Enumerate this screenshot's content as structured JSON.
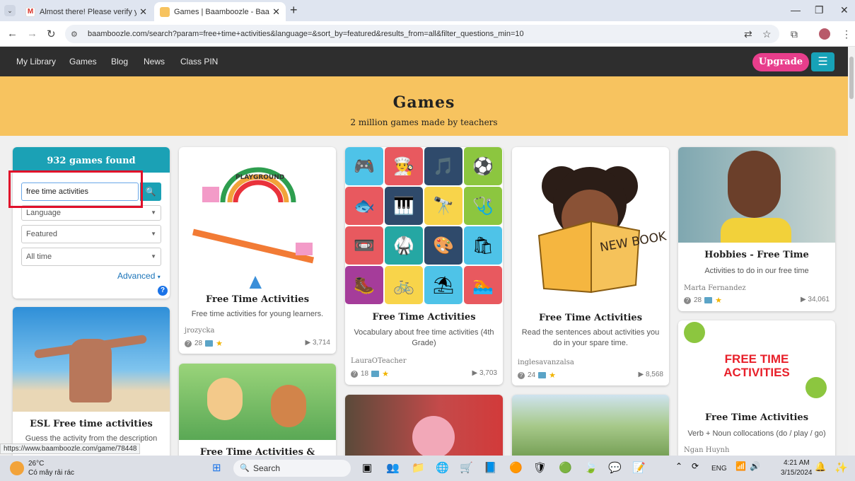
{
  "browser": {
    "tabs": [
      {
        "title": "Almost there! Please verify your",
        "favicon": "gmail-icon"
      },
      {
        "title": "Games | Baamboozle - Baambo",
        "favicon": "baamboozle-icon"
      }
    ],
    "url": "baamboozle.com/search?param=free+time+activities&language=&sort_by=featured&results_from=all&filter_questions_min=10",
    "status_url": "https://www.baamboozle.com/game/78448"
  },
  "nav": {
    "links": [
      "My Library",
      "Games",
      "Blog",
      "News",
      "Class PIN"
    ],
    "upgrade": "Upgrade"
  },
  "hero": {
    "title": "Games",
    "subtitle": "2 million games made by teachers"
  },
  "filters": {
    "count": "932 games found",
    "search_value": "free time activities",
    "language": "Language",
    "sort": "Featured",
    "time": "All time",
    "advanced": "Advanced"
  },
  "cards": [
    {
      "title": "ESL Free time activities",
      "desc": "Guess the activity from the description"
    },
    {
      "title": "Free Time Activities",
      "desc": "Free time activities for young learners.",
      "author": "jrozycka",
      "questions": "28",
      "plays": "3,714"
    },
    {
      "title": "Free Time Activities & Favorite"
    },
    {
      "title": "Free Time Activities",
      "desc": "Vocabulary about free time activities (4th Grade)",
      "author": "LauraOTeacher",
      "questions": "18",
      "plays": "3,703"
    },
    {
      "title": "Free Time Activities",
      "desc": "Read the sentences about activities you do in your spare time.",
      "author": "inglesavanzalsa",
      "questions": "24",
      "plays": "8,568",
      "book_text": "NEW BOOK"
    },
    {
      "title": "Hobbies - Free Time",
      "desc": "Activities to do in our free time",
      "author": "Marta Fernandez",
      "questions": "28",
      "plays": "34,061"
    },
    {
      "title": "Free Time Activities",
      "desc": "Verb + Noun collocations (do / play / go)",
      "author": "Ngan Huynh",
      "image_text": "FREE TIME ACTIVITIES"
    }
  ],
  "playground_sign": "PLAYGROUND",
  "taskbar": {
    "weather_temp": "26°C",
    "weather_desc": "Có mây rải rác",
    "search": "Search",
    "lang": "ENG",
    "time": "4:21 AM",
    "date": "3/15/2024"
  },
  "colors": {
    "accent": "#1ba1b5",
    "upgrade": "#e83e8c",
    "hero": "#f7c35f",
    "highlight_box": "#e0102a"
  }
}
